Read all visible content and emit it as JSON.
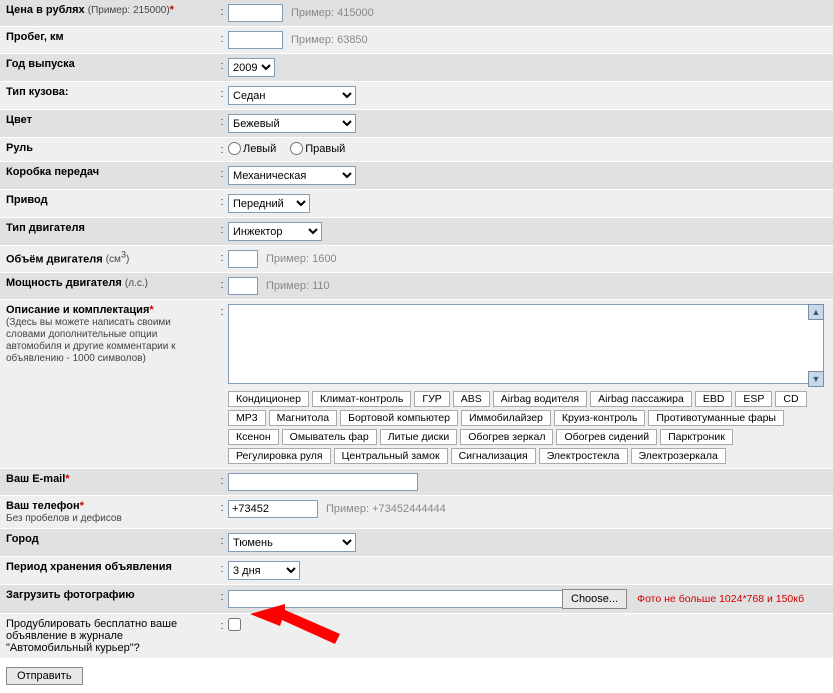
{
  "rows": {
    "price": {
      "label": "Цена в рублях",
      "sub": "(Пример: 215000)",
      "req": true,
      "hint": "Пример: 415000"
    },
    "mileage": {
      "label": "Пробег, км",
      "hint": "Пример: 63850"
    },
    "year": {
      "label": "Год выпуска",
      "value": "2009"
    },
    "body": {
      "label": "Тип кузова:",
      "value": "Седан"
    },
    "color": {
      "label": "Цвет",
      "value": "Бежевый"
    },
    "wheel": {
      "label": "Руль",
      "opt1": "Левый",
      "opt2": "Правый"
    },
    "gearbox": {
      "label": "Коробка передач",
      "value": "Механическая"
    },
    "drive": {
      "label": "Привод",
      "value": "Передний"
    },
    "engine_type": {
      "label": "Тип двигателя",
      "value": "Инжектор"
    },
    "engine_vol": {
      "label_a": "Объём двигателя ",
      "label_b": "(см",
      "label_c": ")",
      "hint": "Пример: 1600"
    },
    "power": {
      "label_a": "Мощность двигателя ",
      "label_b": "(л.с.)",
      "hint": "Пример: 110"
    },
    "desc": {
      "label": "Описание и комплектация",
      "req": true,
      "sub": "(Здесь вы можете написать своими словами дополнительные опции автомобиля и другие комментарии к объявлению - 1000 символов)"
    },
    "email": {
      "label": "Ваш E-mail",
      "req": true
    },
    "phone": {
      "label": "Ваш телефон",
      "req": true,
      "sub": "Без пробелов и дефисов",
      "value": "+73452",
      "hint": "Пример: +73452444444"
    },
    "city": {
      "label": "Город",
      "value": "Тюмень"
    },
    "period": {
      "label": "Период хранения объявления",
      "value": "3 дня"
    },
    "photo": {
      "label": "Загрузить фотографию",
      "btn": "Choose...",
      "note": "Фото не больше 1024*768 и 150кб"
    },
    "dup": {
      "label": "Продублировать бесплатно ваше объявление в журнале \"Автомобильный курьер\"?"
    }
  },
  "tags": [
    "Кондиционер",
    "Климат-контроль",
    "ГУР",
    "ABS",
    "Airbag водителя",
    "Airbag пассажира",
    "EBD",
    "ESP",
    "CD",
    "MP3",
    "Магнитола",
    "Бортовой компьютер",
    "Иммобилайзер",
    "Круиз-контроль",
    "Противотуманные фары",
    "Ксенон",
    "Омыватель фар",
    "Литые диски",
    "Обогрев зеркал",
    "Обогрев сидений",
    "Парктроник",
    "Регулировка руля",
    "Центральный замок",
    "Сигнализация",
    "Электростекла",
    "Электрозеркала"
  ],
  "submit": "Отправить"
}
